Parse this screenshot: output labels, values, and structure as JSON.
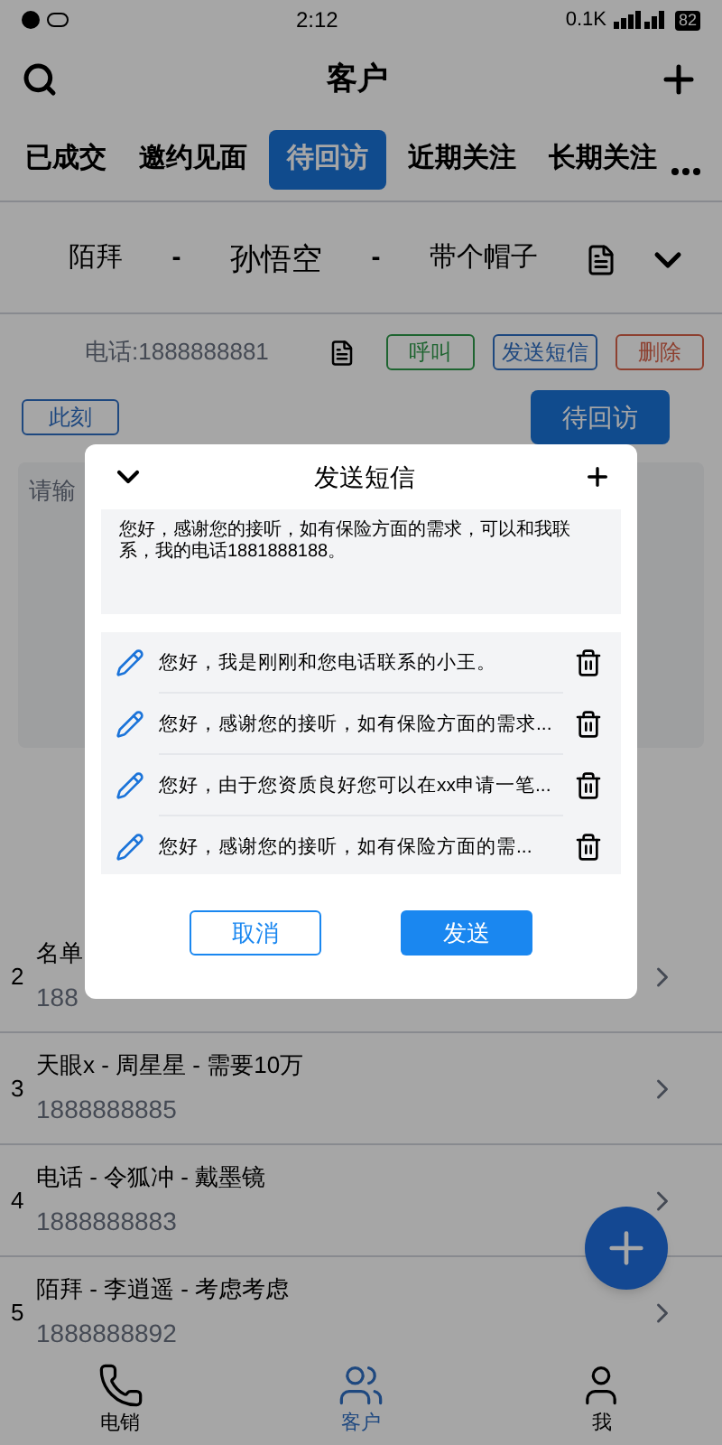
{
  "status_bar": {
    "time": "2:12",
    "network_speed": "0.1K",
    "battery": "82"
  },
  "header": {
    "title": "客户"
  },
  "tabs": [
    {
      "label": "已成交",
      "selected": false
    },
    {
      "label": "邀约见面",
      "selected": false
    },
    {
      "label": "待回访",
      "selected": true
    },
    {
      "label": "近期关注",
      "selected": false
    },
    {
      "label": "长期关注",
      "selected": false
    }
  ],
  "record": {
    "parts": [
      "陌拜",
      "-",
      "孙悟空",
      "-",
      "带个帽子"
    ]
  },
  "contact": {
    "phone": "电话:1888888881",
    "actions": [
      {
        "label": "呼叫",
        "kind": "call"
      },
      {
        "label": "发送短信",
        "kind": "sms"
      },
      {
        "label": "删除",
        "kind": "delete"
      }
    ]
  },
  "time_tag": "此刻",
  "status_button": "待回访",
  "note_field": {
    "placeholder": "请输"
  },
  "customers": [
    {
      "index": "2",
      "title": "名单",
      "phone": "188"
    },
    {
      "index": "3",
      "title": "天眼x - 周星星 - 需要10万",
      "phone": "1888888885"
    },
    {
      "index": "4",
      "title": "电话 - 令狐冲 - 戴墨镜",
      "phone": "1888888883"
    },
    {
      "index": "5",
      "title": "陌拜 - 李逍遥 - 考虑考虑",
      "phone": "1888888892"
    }
  ],
  "bottom_nav": [
    {
      "label": "电销",
      "selected": false
    },
    {
      "label": "客户",
      "selected": true
    },
    {
      "label": "我",
      "selected": false
    }
  ],
  "dialog": {
    "title": "发送短信",
    "message": "您好，感谢您的接听，如有保险方面的需求，可以和我联系，我的电话1881888188。",
    "templates": [
      "您好，我是刚刚和您电话联系的小王。",
      "您好，感谢您的接听，如有保险方面的需求...",
      "您好，由于您资质良好您可以在xx申请一笔...",
      "您好，感谢您的接听，如有保险方面的需..."
    ],
    "buttons": [
      {
        "label": "取消",
        "kind": "secondary"
      },
      {
        "label": "发送",
        "kind": "primary"
      }
    ]
  }
}
